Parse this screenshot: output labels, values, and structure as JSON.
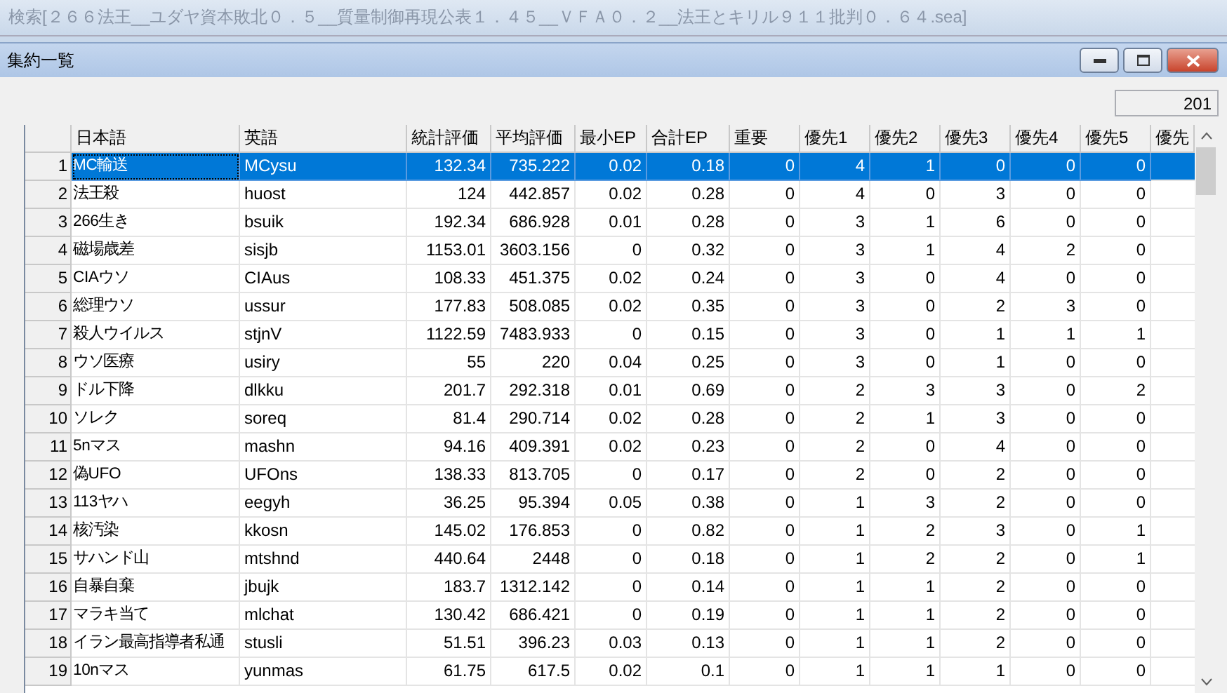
{
  "outer_window": {
    "title": "検索[２６６法王__ユダヤ資本敗北０．５__質量制御再現公表１．４５__ＶＦＡ０．２__法王とキリル９１１批判０．６４.sea]"
  },
  "window": {
    "title": "集約一覧"
  },
  "count_field": {
    "value": "201"
  },
  "table": {
    "columns": [
      "日本語",
      "英語",
      "統計評価",
      "平均評価",
      "最小EP",
      "合計EP",
      "重要",
      "優先1",
      "優先2",
      "優先3",
      "優先4",
      "優先5",
      "優先"
    ],
    "rows": [
      {
        "num": "1",
        "selected": true,
        "cells": [
          "MC輸送",
          "MCysu",
          "132.34",
          "735.222",
          "0.02",
          "0.18",
          "0",
          "4",
          "1",
          "0",
          "0",
          "0"
        ]
      },
      {
        "num": "2",
        "selected": false,
        "cells": [
          "法王殺",
          "huost",
          "124",
          "442.857",
          "0.02",
          "0.28",
          "0",
          "4",
          "0",
          "3",
          "0",
          "0"
        ]
      },
      {
        "num": "3",
        "selected": false,
        "cells": [
          "266生き",
          "bsuik",
          "192.34",
          "686.928",
          "0.01",
          "0.28",
          "0",
          "3",
          "1",
          "6",
          "0",
          "0"
        ]
      },
      {
        "num": "4",
        "selected": false,
        "cells": [
          "磁場歳差",
          "sisjb",
          "1153.01",
          "3603.156",
          "0",
          "0.32",
          "0",
          "3",
          "1",
          "4",
          "2",
          "0"
        ]
      },
      {
        "num": "5",
        "selected": false,
        "cells": [
          "CIAウソ",
          "CIAus",
          "108.33",
          "451.375",
          "0.02",
          "0.24",
          "0",
          "3",
          "0",
          "4",
          "0",
          "0"
        ]
      },
      {
        "num": "6",
        "selected": false,
        "cells": [
          "総理ウソ",
          "ussur",
          "177.83",
          "508.085",
          "0.02",
          "0.35",
          "0",
          "3",
          "0",
          "2",
          "3",
          "0"
        ]
      },
      {
        "num": "7",
        "selected": false,
        "cells": [
          "殺人ウイルス",
          "stjnV",
          "1122.59",
          "7483.933",
          "0",
          "0.15",
          "0",
          "3",
          "0",
          "1",
          "1",
          "1"
        ]
      },
      {
        "num": "8",
        "selected": false,
        "cells": [
          "ウソ医療",
          "usiry",
          "55",
          "220",
          "0.04",
          "0.25",
          "0",
          "3",
          "0",
          "1",
          "0",
          "0"
        ]
      },
      {
        "num": "9",
        "selected": false,
        "cells": [
          "ドル下降",
          "dlkku",
          "201.7",
          "292.318",
          "0.01",
          "0.69",
          "0",
          "2",
          "3",
          "3",
          "0",
          "2"
        ]
      },
      {
        "num": "10",
        "selected": false,
        "cells": [
          "ソレク",
          "soreq",
          "81.4",
          "290.714",
          "0.02",
          "0.28",
          "0",
          "2",
          "1",
          "3",
          "0",
          "0"
        ]
      },
      {
        "num": "11",
        "selected": false,
        "cells": [
          "5nマス",
          "mashn",
          "94.16",
          "409.391",
          "0.02",
          "0.23",
          "0",
          "2",
          "0",
          "4",
          "0",
          "0"
        ]
      },
      {
        "num": "12",
        "selected": false,
        "cells": [
          "偽UFO",
          "UFOns",
          "138.33",
          "813.705",
          "0",
          "0.17",
          "0",
          "2",
          "0",
          "2",
          "0",
          "0"
        ]
      },
      {
        "num": "13",
        "selected": false,
        "cells": [
          "113ヤハ",
          "eegyh",
          "36.25",
          "95.394",
          "0.05",
          "0.38",
          "0",
          "1",
          "3",
          "2",
          "0",
          "0"
        ]
      },
      {
        "num": "14",
        "selected": false,
        "cells": [
          "核汚染",
          "kkosn",
          "145.02",
          "176.853",
          "0",
          "0.82",
          "0",
          "1",
          "2",
          "3",
          "0",
          "1"
        ]
      },
      {
        "num": "15",
        "selected": false,
        "cells": [
          "サハンド山",
          "mtshnd",
          "440.64",
          "2448",
          "0",
          "0.18",
          "0",
          "1",
          "2",
          "2",
          "0",
          "1"
        ]
      },
      {
        "num": "16",
        "selected": false,
        "cells": [
          "自暴自棄",
          "jbujk",
          "183.7",
          "1312.142",
          "0",
          "0.14",
          "0",
          "1",
          "1",
          "2",
          "0",
          "0"
        ]
      },
      {
        "num": "17",
        "selected": false,
        "cells": [
          "マラキ当て",
          "mlchat",
          "130.42",
          "686.421",
          "0",
          "0.19",
          "0",
          "1",
          "1",
          "2",
          "0",
          "0"
        ]
      },
      {
        "num": "18",
        "selected": false,
        "cells": [
          "イラン最高指導者私通",
          "stusli",
          "51.51",
          "396.23",
          "0.03",
          "0.13",
          "0",
          "1",
          "1",
          "2",
          "0",
          "0"
        ]
      },
      {
        "num": "19",
        "selected": false,
        "cells": [
          "10nマス",
          "yunmas",
          "61.75",
          "617.5",
          "0.02",
          "0.1",
          "0",
          "1",
          "1",
          "1",
          "0",
          "0"
        ]
      }
    ]
  }
}
